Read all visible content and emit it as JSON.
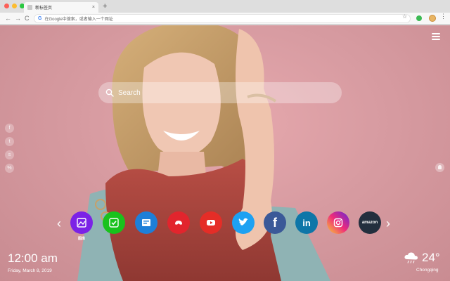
{
  "browser": {
    "tab_title": "新标签页",
    "tab_close": "×",
    "new_tab": "+",
    "address_placeholder": "在Google中搜索，或者输入一个网址",
    "google_glyph": "G",
    "star_glyph": "☆",
    "menu_glyph": "⋮",
    "back_glyph": "←",
    "forward_glyph": "→",
    "reload_glyph": "C"
  },
  "page": {
    "search_placeholder": "Search",
    "social": [
      {
        "icon": "facebook-icon",
        "glyph": "f"
      },
      {
        "icon": "twitter-icon",
        "glyph": "t"
      },
      {
        "icon": "share-icon",
        "glyph": "s"
      },
      {
        "icon": "link-icon",
        "glyph": "%"
      }
    ],
    "apps": [
      {
        "name": "图库",
        "icon": "gallery-icon",
        "color": "#7b22e6",
        "label": "图库"
      },
      {
        "name": "wechat",
        "icon": "check-icon",
        "color": "#19c21c",
        "label": ""
      },
      {
        "name": "news",
        "icon": "news-icon",
        "color": "#1e7fd8",
        "label": ""
      },
      {
        "name": "game",
        "icon": "gamepad-icon",
        "color": "#e2252d",
        "label": ""
      },
      {
        "name": "youtube",
        "icon": "youtube-icon",
        "color": "#e52d27",
        "label": ""
      },
      {
        "name": "twitter",
        "icon": "twitter-icon",
        "color": "#1da1f2",
        "label": ""
      },
      {
        "name": "facebook",
        "icon": "facebook-icon",
        "color": "#3b5998",
        "label": ""
      },
      {
        "name": "linkedin",
        "icon": "linkedin-icon",
        "color": "#0e76a8",
        "label": ""
      },
      {
        "name": "instagram",
        "icon": "instagram-icon",
        "color": "#c13584",
        "label": ""
      },
      {
        "name": "amazon",
        "icon": "amazon-icon",
        "color": "#232f3e",
        "label": ""
      }
    ],
    "arrows": {
      "prev": "‹",
      "next": "›"
    },
    "clock": {
      "time": "12:00 am",
      "date": "Friday, March 8, 2019"
    },
    "weather": {
      "temp": "24°",
      "city": "Chongqing",
      "icon": "cloud-rain-icon"
    },
    "colors": {
      "accent_text": "#ffffff",
      "background": "#d79ba1"
    }
  }
}
